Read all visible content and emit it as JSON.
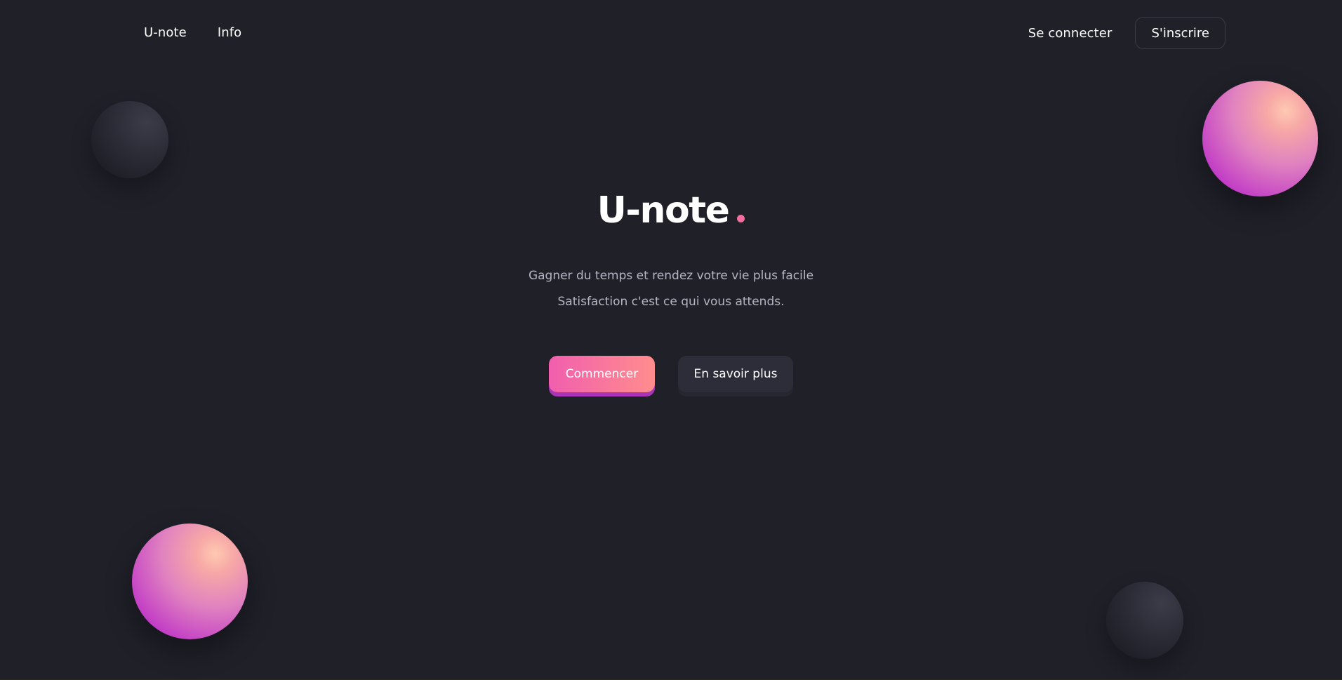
{
  "nav": {
    "brand_label": "U-note",
    "info_label": "Info",
    "login_label": "Se connecter",
    "signup_label": "S'inscrire"
  },
  "hero": {
    "title": "U-note",
    "subtitle_line1": "Gagner du temps et rendez votre vie plus facile",
    "subtitle_line2": "Satisfaction c'est ce qui vous attends.",
    "primary_button": "Commencer",
    "secondary_button": "En savoir plus"
  },
  "colors": {
    "background": "#1f2028",
    "accent_pink": "#f36e9e",
    "gradient_start": "#f15fae",
    "gradient_end": "#ff8d8d",
    "secondary_button": "#2c2d38"
  }
}
